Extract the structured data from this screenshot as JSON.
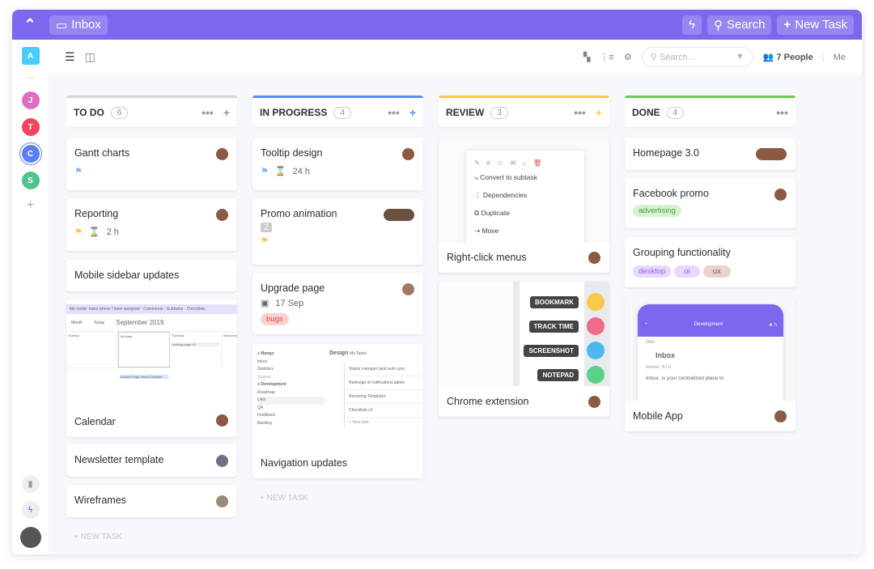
{
  "header": {
    "inbox": "Inbox",
    "search": "Search",
    "new_task": "New Task"
  },
  "sidebar": {
    "items": [
      {
        "label": "A",
        "color": "#49ccf9"
      },
      {
        "label": "J",
        "color": "#e06cc0"
      },
      {
        "label": "T",
        "color": "#f3455c"
      },
      {
        "label": "C",
        "color": "#5c7ef5"
      },
      {
        "label": "S",
        "color": "#4fc48f"
      }
    ],
    "add": "+"
  },
  "toolbar": {
    "search_placeholder": "Search...",
    "people": "7 People",
    "me": "Me"
  },
  "colors": {
    "brand": "#7b68ee",
    "todo": "#d3d5da",
    "in_progress": "#5a8df5",
    "review": "#f8c84b",
    "done": "#6bc950"
  },
  "columns": [
    {
      "title": "TO DO",
      "count": "6",
      "new_task": "+ NEW TASK",
      "cards": [
        {
          "title": "Gantt charts"
        },
        {
          "title": "Reporting",
          "time": "2 h"
        },
        {
          "title": "Mobile sidebar updates"
        },
        {
          "title": "Calendar",
          "image": {
            "bar": "Me mode: tasks where I have assigned · Comments · Subtasks · Checklists",
            "month": "September 2019",
            "view": "Month",
            "today": "Today",
            "days": [
              "Sunday",
              "Monday",
              "Tuesday",
              "Wednesday"
            ],
            "event1": "Landing page v3",
            "event2": "Unused Page Views Estimate"
          }
        },
        {
          "title": "Newsletter template"
        },
        {
          "title": "Wireframes"
        }
      ]
    },
    {
      "title": "IN PROGRESS",
      "count": "4",
      "new_task": "+ NEW TASK",
      "cards": [
        {
          "title": "Tooltip design",
          "time": "24 h"
        },
        {
          "title": "Promo animation",
          "badge": "2"
        },
        {
          "title": "Upgrade page",
          "date": "17 Sep",
          "tag": "bugs"
        },
        {
          "title": "Navigation updates",
          "image": {
            "workspace": "Mango",
            "space": "Design",
            "tab": "My Tasks",
            "nav": [
              "Inbox",
              "Statistics",
              "Spaces",
              "Development",
              "Roadmap",
              "Lists",
              "QA",
              "Feedback",
              "Backlog"
            ],
            "tasks": [
              "Status manager (and auto sync",
              "Redesign of notifications labels",
              "Recurring Templates",
              "Checklists v2"
            ],
            "new": "+ New task"
          }
        }
      ]
    },
    {
      "title": "REVIEW",
      "count": "3",
      "cards": [
        {
          "title": "Right-click menus",
          "menu": [
            "Convert to subtask",
            "Dependencies",
            "Duplicate",
            "Move"
          ]
        },
        {
          "title": "Chrome extension",
          "labels": [
            "BOOKMARK",
            "TRACK TIME",
            "SCREENSHOT",
            "NOTEPAD"
          ]
        }
      ]
    },
    {
      "title": "DONE",
      "count": "4",
      "cards": [
        {
          "title": "Homepage 3.0"
        },
        {
          "title": "Facebook promo",
          "tag": "advertising"
        },
        {
          "title": "Grouping functionality",
          "tags": [
            "desktop",
            "ui",
            "ux"
          ]
        },
        {
          "title": "Mobile App",
          "image": {
            "space": "Development",
            "doc": "Doc",
            "heading": "Inbox",
            "style": "Normal",
            "text": "Inbox, is your centralized place to"
          }
        }
      ]
    }
  ]
}
